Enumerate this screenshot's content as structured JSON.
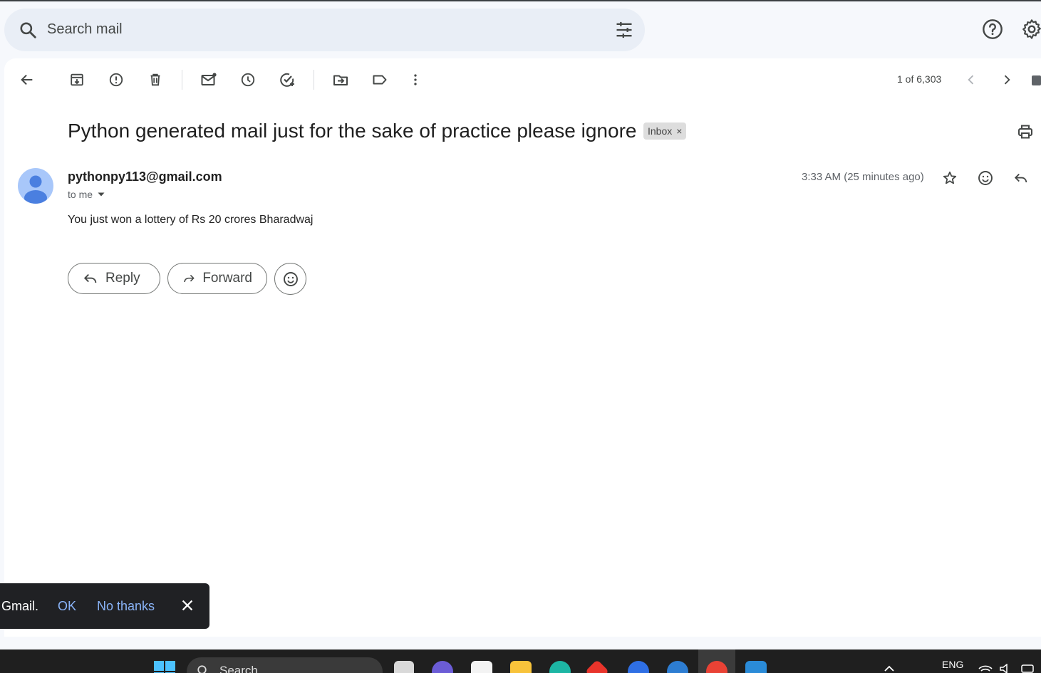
{
  "search": {
    "placeholder": "Search mail"
  },
  "header_icons": [
    "help-icon",
    "settings-icon"
  ],
  "toolbar": {
    "icons": [
      "back-arrow-icon",
      "archive-icon",
      "report-spam-icon",
      "delete-icon",
      "mark-unread-icon",
      "snooze-icon",
      "add-task-icon",
      "move-to-icon",
      "label-icon",
      "more-vert-icon"
    ],
    "counter": "1 of 6,303",
    "nav_icons": [
      "newer-chevron-icon",
      "older-chevron-icon"
    ]
  },
  "email": {
    "subject": "Python generated mail just for the sake of practice please ignore",
    "label": "Inbox",
    "label_remove": "×",
    "sender": "pythonpy113@gmail.com",
    "recipient": "to me",
    "time": "3:33 AM (25 minutes ago)",
    "body": "You just won a lottery of Rs 20 crores Bharadwaj"
  },
  "actions": {
    "reply": "Reply",
    "forward": "Forward"
  },
  "snackbar": {
    "text": "Gmail.",
    "ok": "OK",
    "no_thanks": "No thanks"
  },
  "taskbar": {
    "search": "Search",
    "language": "ENG"
  },
  "colors": {
    "accent_blue": "#8ab4f8",
    "avatar": "#a8c7fa",
    "avatar_dark": "#4a7fe0"
  }
}
